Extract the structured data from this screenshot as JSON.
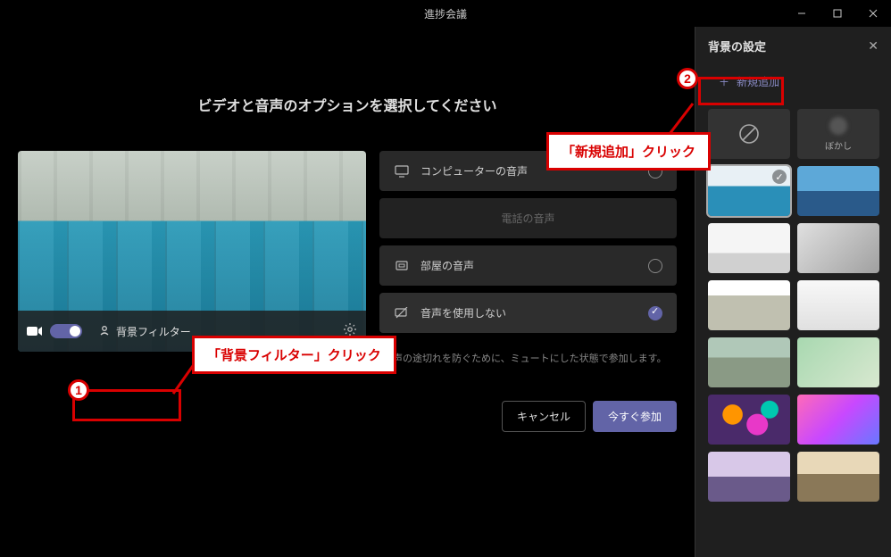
{
  "window": {
    "title": "進捗会議"
  },
  "heading": "ビデオと音声のオプションを選択してください",
  "preview_bar": {
    "bg_filter_label": "背景フィルター"
  },
  "audio": {
    "computer": "コンピューターの音声",
    "phone": "電話の音声",
    "room": "部屋の音声",
    "none": "音声を使用しない",
    "hint": "音声の途切れを防ぐために、ミュートにした状態で参加します。"
  },
  "footer": {
    "cancel": "キャンセル",
    "join": "今すぐ参加"
  },
  "right_pane": {
    "title": "背景の設定",
    "add_new": "新規追加",
    "blur_label": "ぼかし"
  },
  "annotations": {
    "step1": "「背景フィルター」クリック",
    "step2": "「新規追加」クリック",
    "badge1": "1",
    "badge2": "2"
  }
}
